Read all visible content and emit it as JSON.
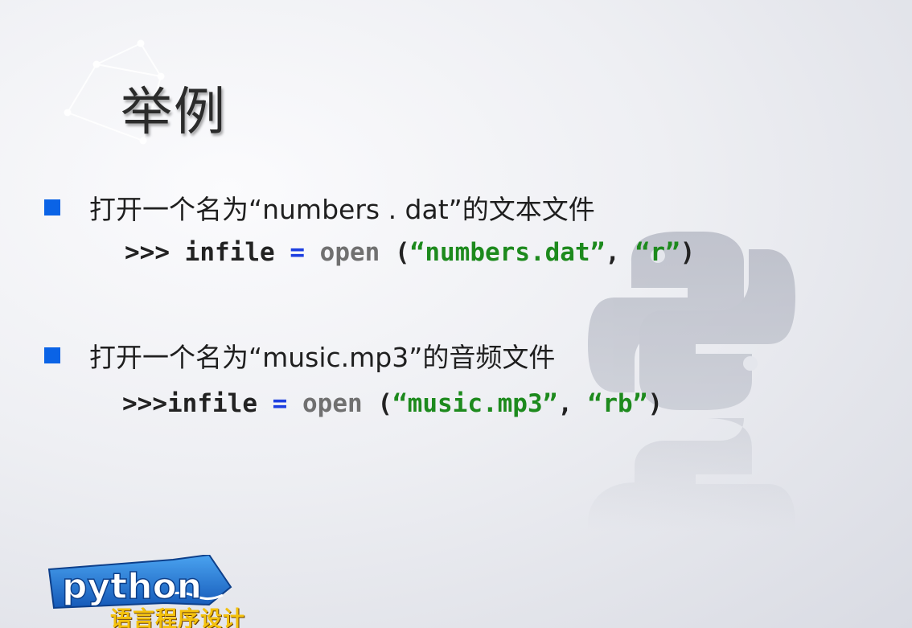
{
  "slide": {
    "title": "举例",
    "items": [
      {
        "bullet": "打开一个名为“numbers . dat”的文本文件",
        "code": {
          "prompt": ">>>",
          "var": "infile",
          "op": "=",
          "func": "open",
          "open_paren": "(",
          "arg1": "“numbers.dat”",
          "sep": ",",
          "arg2": "“r”",
          "close_paren": ")"
        }
      },
      {
        "bullet": "打开一个名为“music.mp3”的音频文件",
        "code": {
          "prompt": ">>>",
          "var": "infile",
          "op": "=",
          "func": "open",
          "open_paren": "(",
          "arg1": "“music.mp3”",
          "sep": ",",
          "arg2": "“rb”",
          "close_paren": ")"
        }
      }
    ]
  },
  "logo": {
    "word": "python",
    "subtitle": "语言程序设计"
  },
  "colors": {
    "bullet": "#0a63e6",
    "keyword_op": "#1d3fe0",
    "func": "#707070",
    "string": "#1d8a1d",
    "logo_blue": "#1a73d9",
    "logo_yellow": "#f4c20d"
  },
  "icons": {
    "decoration": "constellation-icon",
    "watermark": "python-logo-icon"
  }
}
